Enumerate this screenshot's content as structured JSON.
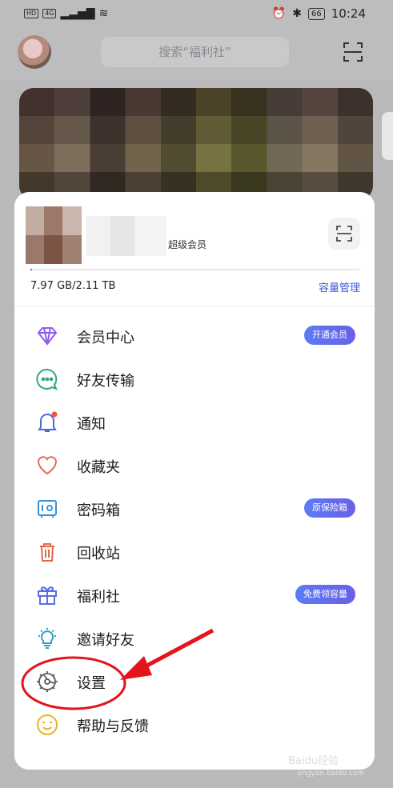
{
  "status_bar": {
    "left_chips": [
      "HD",
      "4G"
    ],
    "battery": "66",
    "time": "10:24"
  },
  "header": {
    "search_placeholder": "搜索“福利社”"
  },
  "account": {
    "vip_label": "超级会员",
    "storage": "7.97 GB/2.11 TB",
    "storage_used_fraction": 0.004,
    "manage_label": "容量管理"
  },
  "menu": [
    {
      "label": "会员中心",
      "icon": "diamond-icon",
      "badge": "开通会员"
    },
    {
      "label": "好友传输",
      "icon": "chat-bubble-icon",
      "badge": ""
    },
    {
      "label": "通知",
      "icon": "bell-icon",
      "badge": ""
    },
    {
      "label": "收藏夹",
      "icon": "heart-icon",
      "badge": ""
    },
    {
      "label": "密码箱",
      "icon": "safe-icon",
      "badge": "原保险箱"
    },
    {
      "label": "回收站",
      "icon": "trash-icon",
      "badge": ""
    },
    {
      "label": "福利社",
      "icon": "gift-icon",
      "badge": "免费领容量"
    },
    {
      "label": "邀请好友",
      "icon": "lightbulb-icon",
      "badge": ""
    },
    {
      "label": "设置",
      "icon": "gear-icon",
      "badge": ""
    },
    {
      "label": "帮助与反馈",
      "icon": "smiley-icon",
      "badge": ""
    }
  ],
  "watermark": {
    "main": "Baidu经验",
    "sub": "jingyan.baidu.com"
  },
  "colors": {
    "accent": "#3f5bd9",
    "annotation": "#e3141b"
  }
}
